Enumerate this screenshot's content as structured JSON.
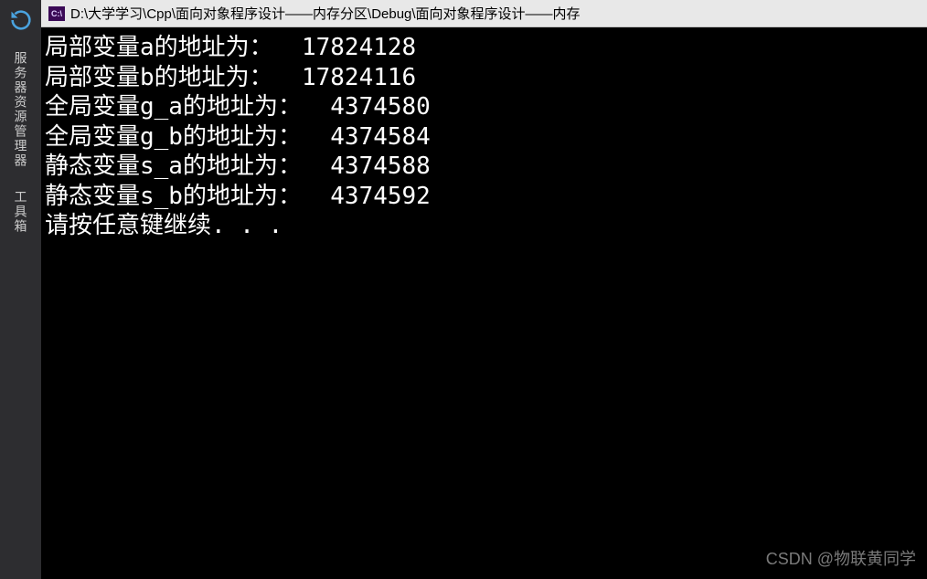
{
  "title": {
    "icon_label": "C:\\",
    "text": "D:\\大学学习\\Cpp\\面向对象程序设计——内存分区\\Debug\\面向对象程序设计——内存"
  },
  "sidebar": {
    "items": [
      "服务器资源管理器",
      "工具箱"
    ]
  },
  "console": {
    "lines": [
      "局部变量a的地址为：  17824128",
      "局部变量b的地址为：  17824116",
      "全局变量g_a的地址为：  4374580",
      "全局变量g_b的地址为：  4374584",
      "静态变量s_a的地址为：  4374588",
      "静态变量s_b的地址为：  4374592",
      "请按任意键继续. . ."
    ]
  },
  "watermark": "CSDN @物联黄同学"
}
